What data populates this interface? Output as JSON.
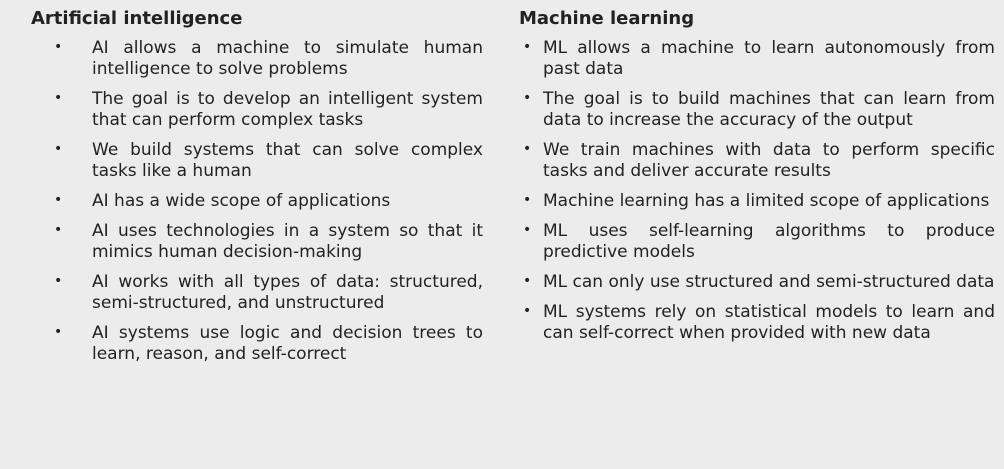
{
  "left_column": {
    "title": "Artificial intelligence",
    "items": [
      "AI allows a machine to simulate human intelligence to solve problems",
      "The goal is to develop an intelligent system that can perform complex tasks",
      "We build systems that can solve complex tasks like a human",
      "AI has a wide scope of applications",
      "AI uses technologies in a system so that it mimics human decision-making",
      "AI works with all types of data: structured, semi-structured, and unstructured",
      "AI systems use logic and decision trees to learn, reason, and self-correct"
    ]
  },
  "right_column": {
    "title": "Machine learning",
    "items": [
      "ML allows a machine to learn autonomously from past data",
      "The goal is to build machines that can learn from data to increase the accuracy of the output",
      "We train machines with data to perform specific tasks and deliver accurate results",
      "Machine learning has a limited scope of applications",
      "ML uses self-learning algorithms to produce predictive models",
      "ML can only use structured and semi-structured data",
      "ML systems rely on statistical models to learn and can self-correct when provided with new data"
    ]
  },
  "bullet_glyph": "•",
  "colors": {
    "background": "#ececec",
    "text": "#222222"
  }
}
